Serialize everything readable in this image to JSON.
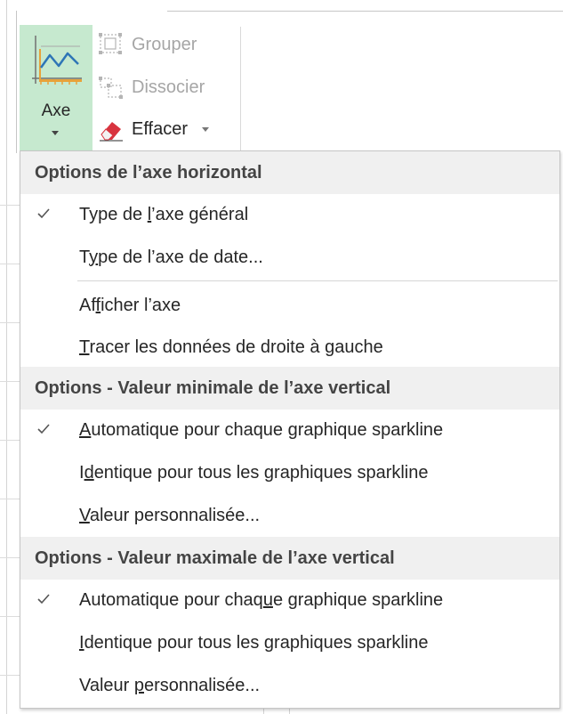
{
  "ribbon": {
    "axe_label": "Axe",
    "grouper_label": "Grouper",
    "dissocier_label": "Dissocier",
    "effacer_label": "Effacer",
    "icons": {
      "axe": "axis-chart-icon",
      "grouper": "group-icon",
      "dissocier": "ungroup-icon",
      "effacer": "eraser-icon"
    },
    "colors": {
      "axe_active_bg": "#c6e9cf",
      "disabled_text": "#a6a6a6",
      "eraser": "#d8343f"
    }
  },
  "menu": {
    "sections": [
      {
        "header": "Options de l’axe horizontal",
        "items": [
          {
            "pre": "Type de ",
            "key": "l",
            "post": "’axe général",
            "checked": true
          },
          {
            "pre": "T",
            "key": "y",
            "post": "pe de l’axe de date...",
            "checked": false
          },
          {
            "pre": "Af",
            "key": "f",
            "post": "icher l’axe",
            "checked": false
          },
          {
            "pre": "",
            "key": "T",
            "post": "racer les données de droite à gauche",
            "checked": false
          }
        ]
      },
      {
        "header": "Options - Valeur minimale de l’axe vertical",
        "items": [
          {
            "pre": "",
            "key": "A",
            "post": "utomatique pour chaque graphique sparkline",
            "checked": true
          },
          {
            "pre": "I",
            "key": "d",
            "post": "entique pour tous les graphiques sparkline",
            "checked": false
          },
          {
            "pre": "",
            "key": "V",
            "post": "aleur personnalisée...",
            "checked": false
          }
        ]
      },
      {
        "header": "Options - Valeur maximale de l’axe vertical",
        "items": [
          {
            "pre": "Automatique pour chaq",
            "key": "u",
            "post": "e graphique sparkline",
            "checked": true
          },
          {
            "pre": "",
            "key": "I",
            "post": "dentique pour tous les graphiques sparkline",
            "checked": false
          },
          {
            "pre": "Valeur ",
            "key": "p",
            "post": "ersonnalisée...",
            "checked": false
          }
        ]
      }
    ]
  }
}
